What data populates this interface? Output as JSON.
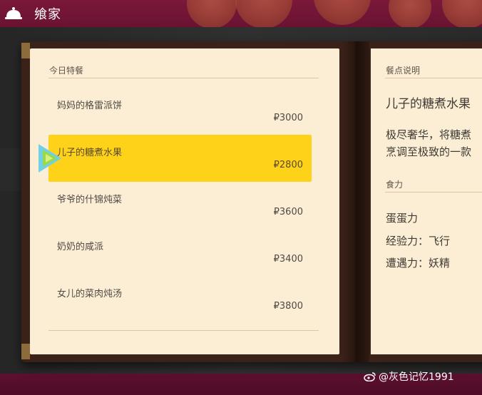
{
  "header": {
    "title": "飨家"
  },
  "menu": {
    "section_label": "今日特餐",
    "items": [
      {
        "name": "妈妈的格雷派饼",
        "price": "₽3000"
      },
      {
        "name": "儿子的糖煮水果",
        "price": "₽2800"
      },
      {
        "name": "爷爷的什锦炖菜",
        "price": "₽3600"
      },
      {
        "name": "奶奶的咸派",
        "price": "₽3400"
      },
      {
        "name": "女儿的菜肉炖汤",
        "price": "₽3800"
      }
    ]
  },
  "detail": {
    "section_label": "餐点说明",
    "title": "儿子的糖煮水果",
    "desc_line1": "极尽奢华，将糖煮",
    "desc_line2": "烹调至极致的一款",
    "power_label": "食力",
    "stats": [
      "蛋蛋力",
      "经验力：飞行",
      "遭遇力：妖精"
    ]
  },
  "watermark": "@灰色记忆1991",
  "colors": {
    "highlight": "#ffd21a",
    "page": "#fbeed5",
    "header": "#7a1839"
  }
}
